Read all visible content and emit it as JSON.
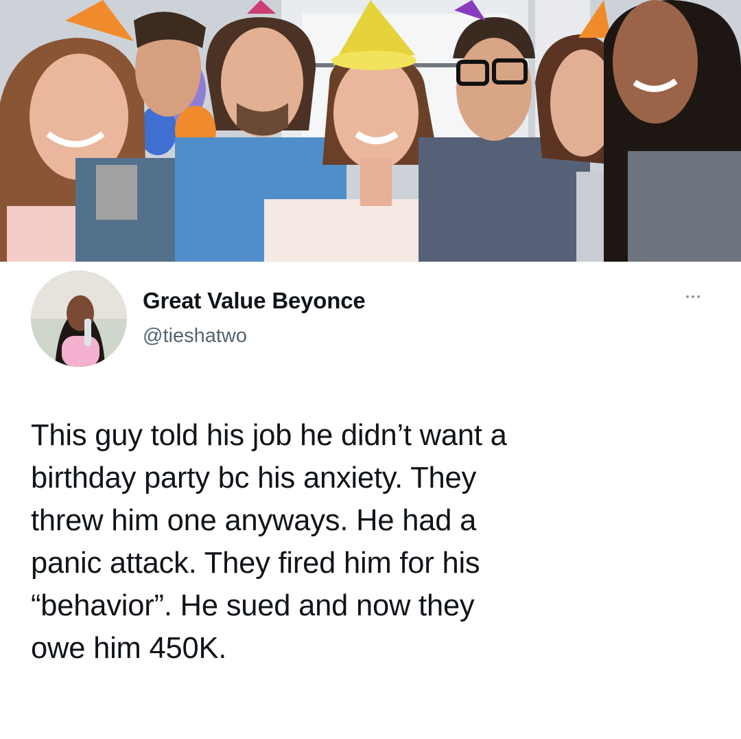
{
  "tweet": {
    "display_name": "Great Value Beyonce",
    "handle": "@tieshatwo",
    "more_icon": "more-horizontal-icon",
    "text_lines": [
      "This guy told his job he didn’t want a",
      "birthday party bc his anxiety. They",
      "threw him one anyways. He had a",
      "panic attack. They fired him for his",
      "“behavior”. He sued and now they",
      "owe him 450K."
    ]
  },
  "colors": {
    "text": "#0f1419",
    "secondary": "#536471",
    "background": "#ffffff"
  }
}
